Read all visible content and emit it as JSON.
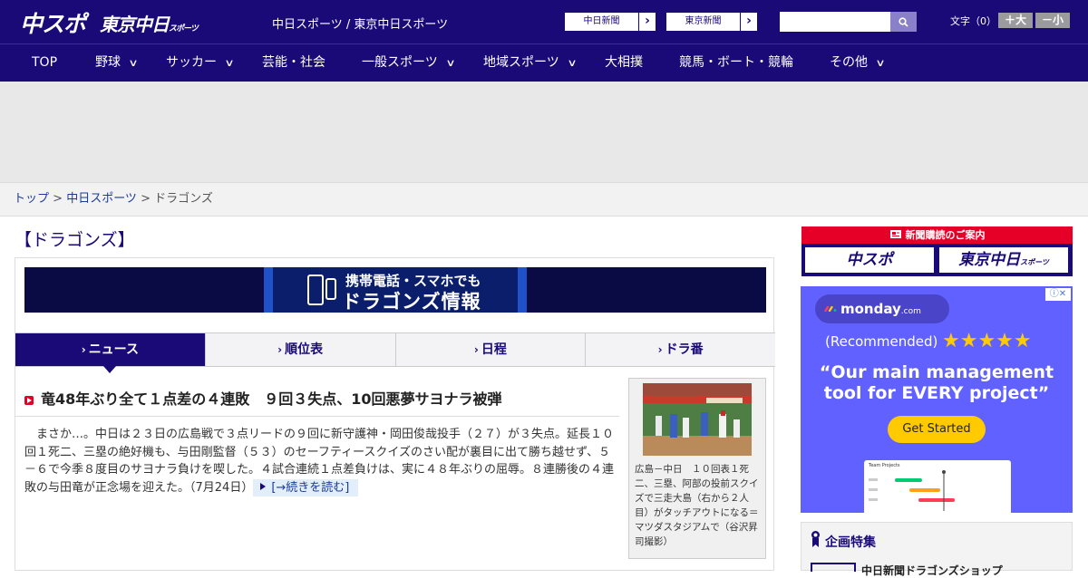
{
  "header": {
    "logo_chunichi_sports": "中スポ",
    "logo_tokyo_chunichi": "東京中日",
    "logo_tokyo_chunichi_sub": "スポーツ",
    "site_title": "中日スポーツ / 東京中日スポーツ",
    "paper_link_1": "中日新聞",
    "paper_link_2": "東京新聞",
    "arrow": "›",
    "search_placeholder": "",
    "font_size_label": "文字（0）",
    "font_larger": "＋大",
    "font_smaller": "－小"
  },
  "nav": {
    "items": [
      {
        "label": "TOP",
        "has_menu": false
      },
      {
        "label": "野球",
        "has_menu": true
      },
      {
        "label": "サッカー",
        "has_menu": true
      },
      {
        "label": "芸能・社会",
        "has_menu": false
      },
      {
        "label": "一般スポーツ",
        "has_menu": true
      },
      {
        "label": "地域スポーツ",
        "has_menu": true
      },
      {
        "label": "大相撲",
        "has_menu": false
      },
      {
        "label": "競馬・ボート・競輪",
        "has_menu": false
      },
      {
        "label": "その他",
        "has_menu": true
      }
    ],
    "chevron": "∨"
  },
  "breadcrumb": {
    "home": "トップ",
    "sep": " > ",
    "section": "中日スポーツ",
    "current": "ドラゴンズ"
  },
  "page": {
    "heading": "【ドラゴンズ】"
  },
  "banner": {
    "line1": "携帯電話・スマホでも",
    "line2": "ドラゴンズ情報"
  },
  "tabs": [
    {
      "label": "ニュース",
      "active": true
    },
    {
      "label": "順位表",
      "active": false
    },
    {
      "label": "日程",
      "active": false
    },
    {
      "label": "ドラ番",
      "active": false
    }
  ],
  "article": {
    "title": "竜48年ぶり全て１点差の４連敗　９回３失点、10回悪夢サヨナラ被弾",
    "body": "　まさか…。中日は２３日の広島戦で３点リードの９回に新守護神・岡田俊哉投手（２７）が３失点。延長１０回１死二、三塁の絶好機も、与田剛監督（５３）のセーフティースクイズのさい配が裏目に出て勝ち越せず、５－６で今季８度目のサヨナラ負けを喫した。４試合連続１点差負けは、実に４８年ぶりの屈辱。８連勝後の４連敗の与田竜が正念場を迎えた。",
    "date": "（7月24日）",
    "read_more": "[→続きを読む]",
    "photo_caption": "広島－中日　１０回表１死二、三塁、阿部の投前スクイズで三走大島（右から２人目）がタッチアウトになる＝マツダスタジアムで（谷沢昇司撮影）"
  },
  "sidebar": {
    "subscribe_heading": "新聞購読のご案内",
    "subscribe_logo_1": "中スポ",
    "subscribe_logo_2": "東京中日",
    "subscribe_logo_2_sub": "スポーツ",
    "ad": {
      "brand": "monday",
      "brand_suffix": ".com",
      "recommended": "(Recommended)",
      "stars": "★★★★★",
      "quote": "“Our main management tool for EVERY project”",
      "cta": "Get Started",
      "card_title": "Team Projects",
      "info": "ⓘ✕"
    },
    "feature_title": "企画特集",
    "feature_item": "中日新聞ドラゴンズショップ"
  },
  "colors": {
    "brand_navy": "#1a0a78",
    "accent_red": "#e60027",
    "ad_purple": "#6161ff"
  }
}
